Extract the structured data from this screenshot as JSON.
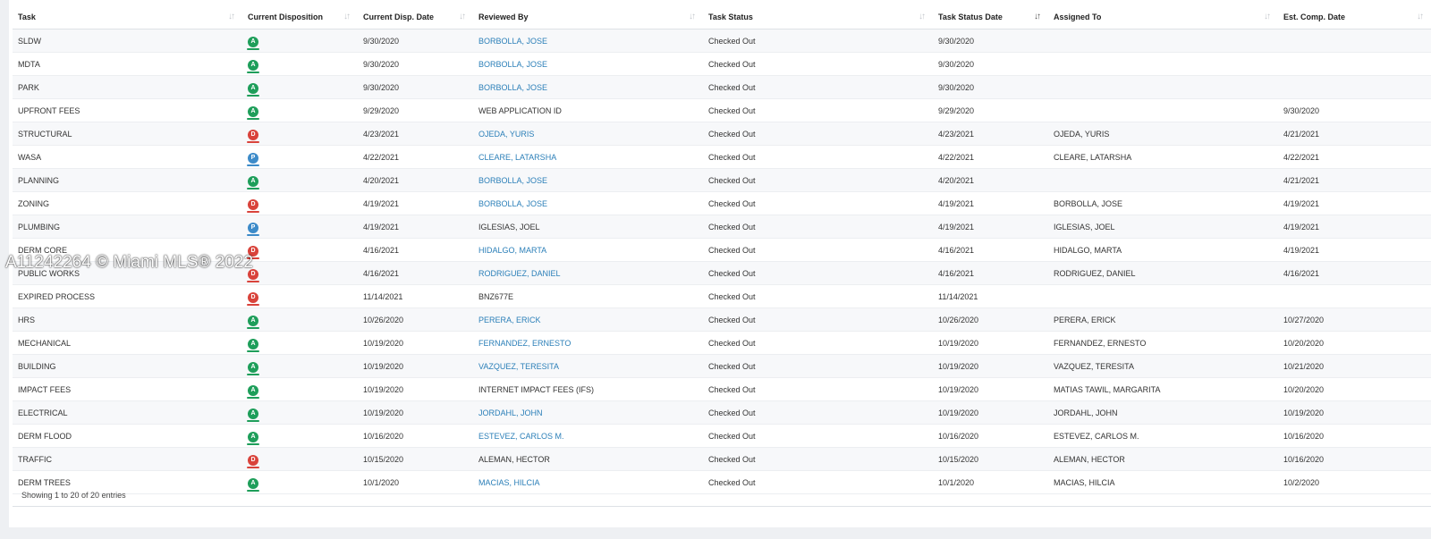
{
  "columns": [
    "Task",
    "Current Disposition",
    "Current Disp. Date",
    "Reviewed By",
    "Task Status",
    "Task Status Date",
    "Assigned To",
    "Est. Comp. Date"
  ],
  "colors": {
    "A": "#1e9e5a",
    "D": "#d9433b",
    "P": "#3d8bc9",
    "link": "#2b7fb8"
  },
  "rows": [
    {
      "task": "SLDW",
      "disp": "A",
      "disp_date": "9/30/2020",
      "reviewed_by": "BORBOLLA, JOSE",
      "reviewed_link": true,
      "status": "Checked Out",
      "status_date": "9/30/2020",
      "assigned": "",
      "est": ""
    },
    {
      "task": "MDTA",
      "disp": "A",
      "disp_date": "9/30/2020",
      "reviewed_by": "BORBOLLA, JOSE",
      "reviewed_link": true,
      "status": "Checked Out",
      "status_date": "9/30/2020",
      "assigned": "",
      "est": ""
    },
    {
      "task": "PARK",
      "disp": "A",
      "disp_date": "9/30/2020",
      "reviewed_by": "BORBOLLA, JOSE",
      "reviewed_link": true,
      "status": "Checked Out",
      "status_date": "9/30/2020",
      "assigned": "",
      "est": ""
    },
    {
      "task": "UPFRONT FEES",
      "disp": "A",
      "disp_date": "9/29/2020",
      "reviewed_by": "WEB APPLICATION ID",
      "reviewed_link": false,
      "status": "Checked Out",
      "status_date": "9/29/2020",
      "assigned": "",
      "est": "9/30/2020"
    },
    {
      "task": "STRUCTURAL",
      "disp": "D",
      "disp_date": "4/23/2021",
      "reviewed_by": "OJEDA, YURIS",
      "reviewed_link": true,
      "status": "Checked Out",
      "status_date": "4/23/2021",
      "assigned": "OJEDA, YURIS",
      "est": "4/21/2021"
    },
    {
      "task": "WASA",
      "disp": "P",
      "disp_date": "4/22/2021",
      "reviewed_by": "CLEARE, LATARSHA",
      "reviewed_link": true,
      "status": "Checked Out",
      "status_date": "4/22/2021",
      "assigned": "CLEARE, LATARSHA",
      "est": "4/22/2021"
    },
    {
      "task": "PLANNING",
      "disp": "A",
      "disp_date": "4/20/2021",
      "reviewed_by": "BORBOLLA, JOSE",
      "reviewed_link": true,
      "status": "Checked Out",
      "status_date": "4/20/2021",
      "assigned": "",
      "est": "4/21/2021"
    },
    {
      "task": "ZONING",
      "disp": "D",
      "disp_date": "4/19/2021",
      "reviewed_by": "BORBOLLA, JOSE",
      "reviewed_link": true,
      "status": "Checked Out",
      "status_date": "4/19/2021",
      "assigned": "BORBOLLA, JOSE",
      "est": "4/19/2021"
    },
    {
      "task": "PLUMBING",
      "disp": "P",
      "disp_date": "4/19/2021",
      "reviewed_by": "IGLESIAS, JOEL",
      "reviewed_link": false,
      "status": "Checked Out",
      "status_date": "4/19/2021",
      "assigned": "IGLESIAS, JOEL",
      "est": "4/19/2021"
    },
    {
      "task": "DERM CORE",
      "disp": "D",
      "disp_date": "4/16/2021",
      "reviewed_by": "HIDALGO, MARTA",
      "reviewed_link": true,
      "status": "Checked Out",
      "status_date": "4/16/2021",
      "assigned": "HIDALGO, MARTA",
      "est": "4/19/2021"
    },
    {
      "task": "PUBLIC WORKS",
      "disp": "D",
      "disp_date": "4/16/2021",
      "reviewed_by": "RODRIGUEZ, DANIEL",
      "reviewed_link": true,
      "status": "Checked Out",
      "status_date": "4/16/2021",
      "assigned": "RODRIGUEZ, DANIEL",
      "est": "4/16/2021"
    },
    {
      "task": "EXPIRED PROCESS",
      "disp": "D",
      "disp_date": "11/14/2021",
      "reviewed_by": "BNZ677E",
      "reviewed_link": false,
      "status": "Checked Out",
      "status_date": "11/14/2021",
      "assigned": "",
      "est": ""
    },
    {
      "task": "HRS",
      "disp": "A",
      "disp_date": "10/26/2020",
      "reviewed_by": "PERERA, ERICK",
      "reviewed_link": true,
      "status": "Checked Out",
      "status_date": "10/26/2020",
      "assigned": "PERERA, ERICK",
      "est": "10/27/2020"
    },
    {
      "task": "MECHANICAL",
      "disp": "A",
      "disp_date": "10/19/2020",
      "reviewed_by": "FERNANDEZ, ERNESTO",
      "reviewed_link": true,
      "status": "Checked Out",
      "status_date": "10/19/2020",
      "assigned": "FERNANDEZ, ERNESTO",
      "est": "10/20/2020"
    },
    {
      "task": "BUILDING",
      "disp": "A",
      "disp_date": "10/19/2020",
      "reviewed_by": "VAZQUEZ, TERESITA",
      "reviewed_link": true,
      "status": "Checked Out",
      "status_date": "10/19/2020",
      "assigned": "VAZQUEZ, TERESITA",
      "est": "10/21/2020"
    },
    {
      "task": "IMPACT FEES",
      "disp": "A",
      "disp_date": "10/19/2020",
      "reviewed_by": "INTERNET IMPACT FEES (IFS)",
      "reviewed_link": false,
      "status": "Checked Out",
      "status_date": "10/19/2020",
      "assigned": "MATIAS TAWIL, MARGARITA",
      "est": "10/20/2020"
    },
    {
      "task": "ELECTRICAL",
      "disp": "A",
      "disp_date": "10/19/2020",
      "reviewed_by": "JORDAHL, JOHN",
      "reviewed_link": true,
      "status": "Checked Out",
      "status_date": "10/19/2020",
      "assigned": "JORDAHL, JOHN",
      "est": "10/19/2020"
    },
    {
      "task": "DERM FLOOD",
      "disp": "A",
      "disp_date": "10/16/2020",
      "reviewed_by": "ESTEVEZ, CARLOS M.",
      "reviewed_link": true,
      "status": "Checked Out",
      "status_date": "10/16/2020",
      "assigned": "ESTEVEZ, CARLOS M.",
      "est": "10/16/2020"
    },
    {
      "task": "TRAFFIC",
      "disp": "D",
      "disp_date": "10/15/2020",
      "reviewed_by": "ALEMAN, HECTOR",
      "reviewed_link": false,
      "status": "Checked Out",
      "status_date": "10/15/2020",
      "assigned": "ALEMAN, HECTOR",
      "est": "10/16/2020"
    },
    {
      "task": "DERM TREES",
      "disp": "A",
      "disp_date": "10/1/2020",
      "reviewed_by": "MACIAS, HILCIA",
      "reviewed_link": true,
      "status": "Checked Out",
      "status_date": "10/1/2020",
      "assigned": "MACIAS, HILCIA",
      "est": "10/2/2020"
    }
  ],
  "footer": "Showing 1 to 20 of 20 entries",
  "watermark": "A11242264 © Miami MLS® 2022"
}
